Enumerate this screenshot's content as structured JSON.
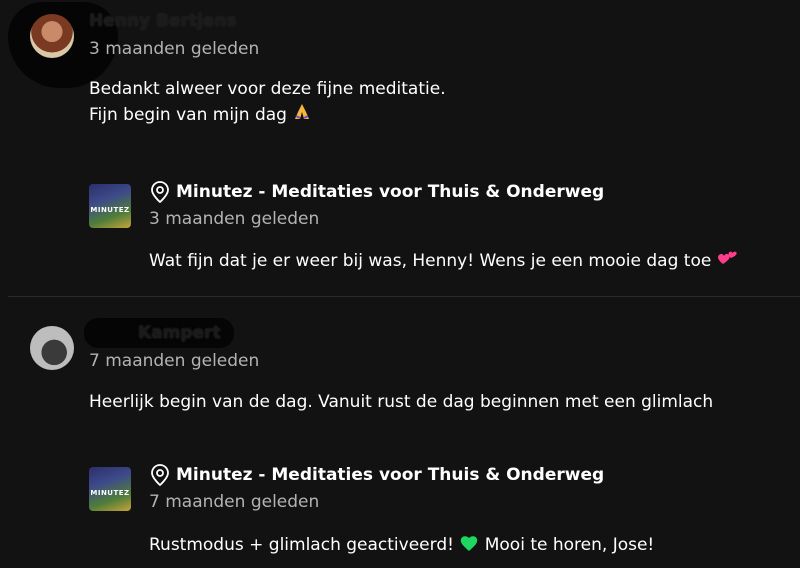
{
  "comments": [
    {
      "author": "Henny Bertjens",
      "time": "3 maanden geleden",
      "text_line1": "Bedankt alweer voor deze fijne meditatie.",
      "text_line2": "Fijn begin van mijn dag",
      "reply": {
        "artist": "Minutez - Meditaties voor Thuis & Onderweg",
        "time": "3 maanden geleden",
        "text": "Wat fijn dat je er weer bij was, Henny! Wens je een mooie dag toe"
      }
    },
    {
      "author": "Kampert",
      "time": "7 maanden geleden",
      "text_line1": "Heerlijk begin van de dag. Vanuit rust de dag beginnen met een glimlach",
      "reply": {
        "artist": "Minutez - Meditaties voor Thuis & Onderweg",
        "time": "7 maanden geleden",
        "text_before": "Rustmodus + glimlach geactiveerd!",
        "text_after": "Mooi te horen, Jose!"
      }
    }
  ],
  "brand_label": "MINUTEZ",
  "icons": {
    "pray": "folded-hands-emoji",
    "hearts": "two-hearts-emoji",
    "green_heart": "green-heart-emoji",
    "artist_badge": "artist-pin-icon"
  },
  "colors": {
    "background": "#121212",
    "secondary_text": "#b3b3b3",
    "heart_pink": "#ff3d8b",
    "heart_green": "#1ed760"
  }
}
